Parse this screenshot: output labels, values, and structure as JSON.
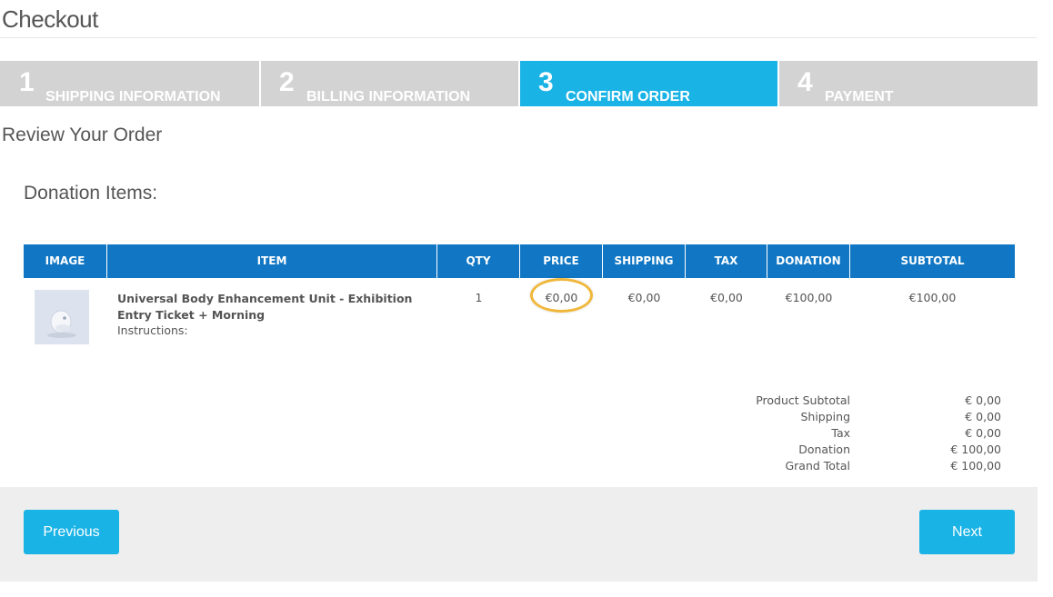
{
  "page": {
    "title": "Checkout"
  },
  "steps": [
    {
      "number": "1",
      "label": "SHIPPING INFORMATION",
      "active": false
    },
    {
      "number": "2",
      "label": "BILLING INFORMATION",
      "active": false
    },
    {
      "number": "3",
      "label": "CONFIRM ORDER",
      "active": true
    },
    {
      "number": "4",
      "label": "PAYMENT",
      "active": false
    }
  ],
  "review": {
    "heading": "Review Your Order",
    "section": "Donation Items:"
  },
  "table": {
    "headers": [
      "IMAGE",
      "ITEM",
      "QTY",
      "PRICE",
      "SHIPPING",
      "TAX",
      "DONATION",
      "SUBTOTAL"
    ],
    "rows": [
      {
        "item": "Universal Body Enhancement Unit - Exhibition Entry Ticket + Morning",
        "instructions": "Instructions:",
        "qty": "1",
        "price": "€0,00",
        "shipping": "€0,00",
        "tax": "€0,00",
        "donation": "€100,00",
        "subtotal": "€100,00"
      }
    ]
  },
  "totals": {
    "product_subtotal_label": "Product Subtotal",
    "product_subtotal": "€ 0,00",
    "shipping_label": "Shipping",
    "shipping": "€ 0,00",
    "tax_label": "Tax",
    "tax": "€ 0,00",
    "donation_label": "Donation",
    "donation": "€ 100,00",
    "grand_total_label": "Grand Total",
    "grand_total": "€ 100,00"
  },
  "buttons": {
    "previous": "Previous",
    "next": "Next"
  },
  "colors": {
    "accent": "#1ab3e6",
    "table_header": "#1177c4",
    "step_inactive": "#d3d3d3",
    "highlight": "#f0b73a"
  }
}
